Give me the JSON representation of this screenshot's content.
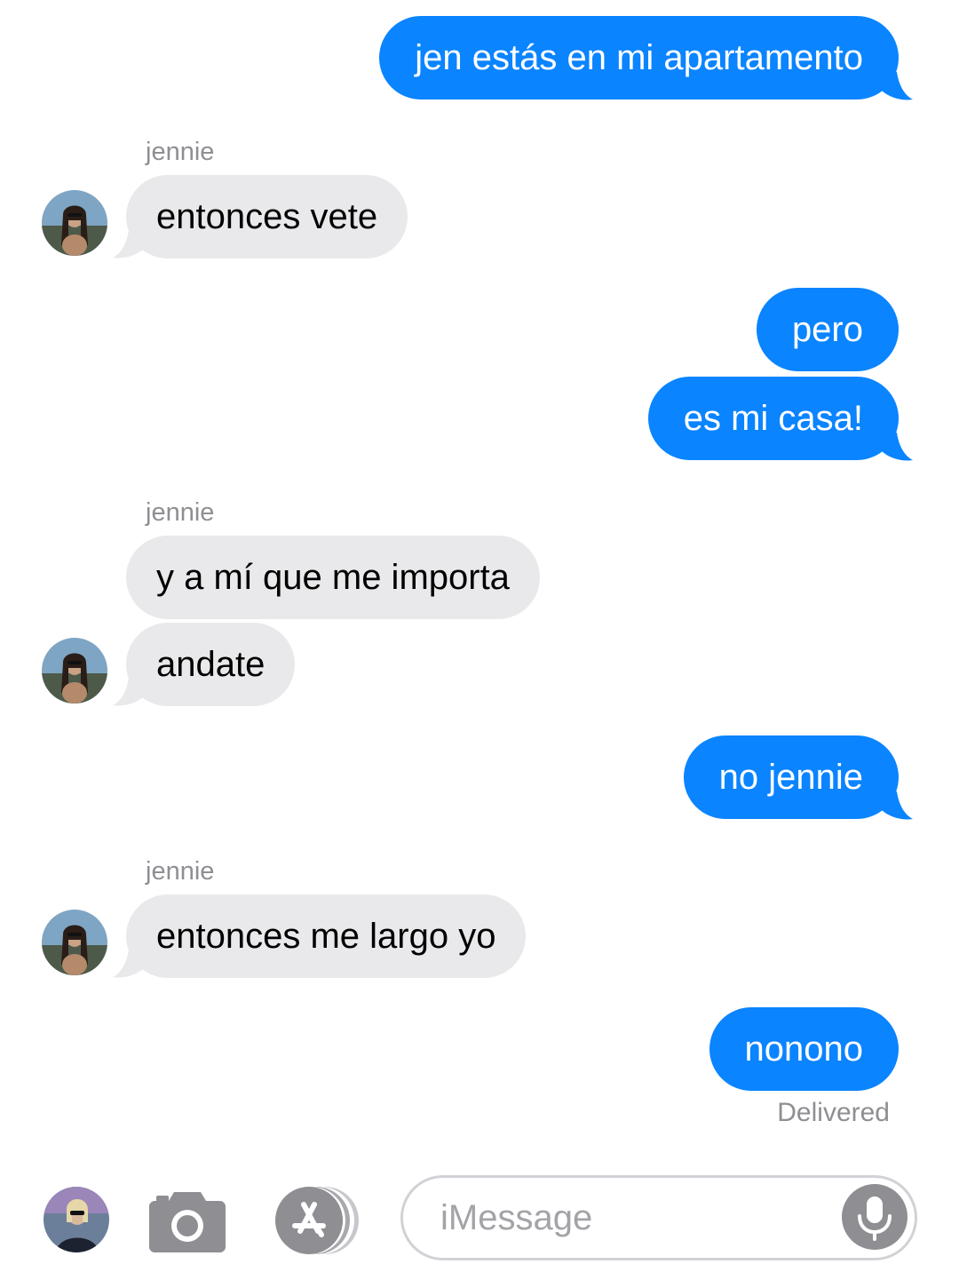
{
  "conversation": {
    "contact_name": "jennie",
    "messages": [
      {
        "direction": "outgoing",
        "text": "jen estás en mi apartamento"
      },
      {
        "direction": "incoming",
        "text": "entonces vete"
      },
      {
        "direction": "outgoing",
        "text": "pero"
      },
      {
        "direction": "outgoing",
        "text": "es mi casa!"
      },
      {
        "direction": "incoming",
        "text": "y a mí que me importa"
      },
      {
        "direction": "incoming",
        "text": "andate"
      },
      {
        "direction": "outgoing",
        "text": "no jennie"
      },
      {
        "direction": "incoming",
        "text": "entonces me largo yo"
      },
      {
        "direction": "outgoing",
        "text": "nonono"
      }
    ],
    "status": "Delivered"
  },
  "composer": {
    "placeholder": "iMessage",
    "icons": [
      "user-avatar",
      "camera-icon",
      "app-store-icon",
      "microphone-icon"
    ]
  },
  "colors": {
    "outgoing_bubble": "#0a84ff",
    "incoming_bubble": "#e9e9eb",
    "secondary_text": "#8e8e93"
  }
}
